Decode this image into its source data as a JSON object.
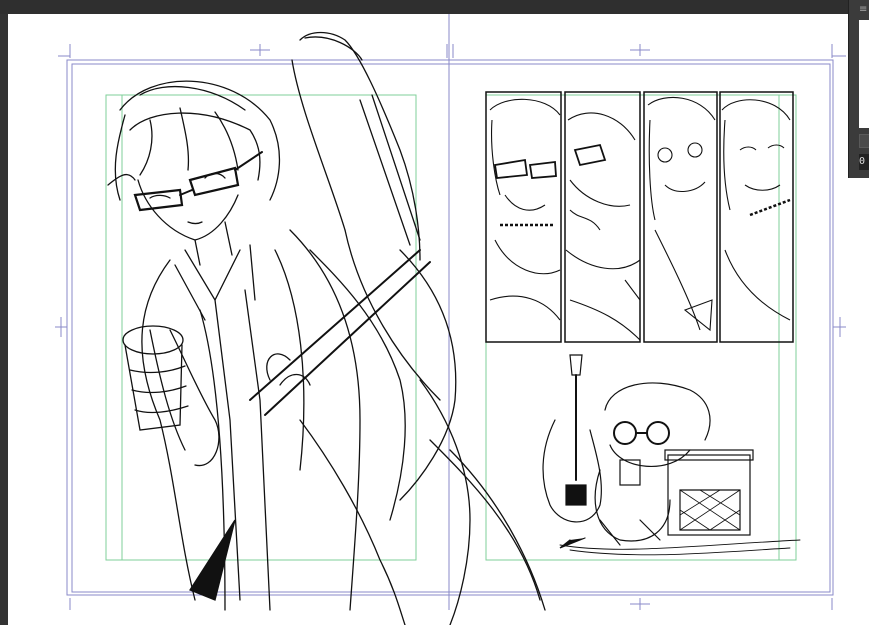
{
  "side_panel": {
    "menu_icon": "hamburger-menu-icon",
    "zoom_value": "0"
  },
  "colors": {
    "frame_line": "#8a8ac8",
    "guide_line": "#7fcf9a",
    "ink": "#111111",
    "app_background": "#3a3a3a"
  }
}
